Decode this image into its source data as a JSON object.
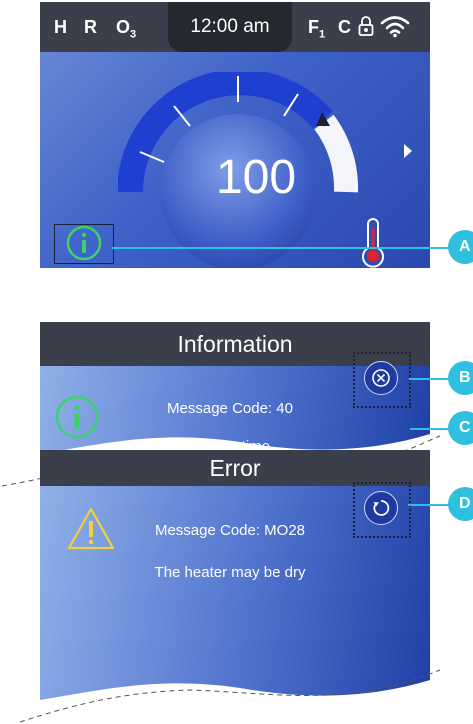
{
  "status_bar": {
    "indicators_left": [
      "H",
      "R",
      "O",
      "3"
    ],
    "time": "12:00 am",
    "indicators_right": [
      "F",
      "1",
      "C"
    ],
    "icons": [
      "lock-icon",
      "wifi-icon"
    ]
  },
  "main": {
    "temperature": "100",
    "icons": [
      "info-icon",
      "thermometer-icon",
      "next-arrow-icon"
    ]
  },
  "callouts": [
    "A",
    "B",
    "C",
    "D"
  ],
  "information_popup": {
    "title": "Information",
    "message_code": "Message Code: 40",
    "message": "Set the time",
    "icons": [
      "info-icon",
      "close-icon"
    ]
  },
  "error_popup": {
    "title": "Error",
    "message_code": "Message Code: MO28",
    "message": "The heater may be dry",
    "icons": [
      "warning-icon",
      "reset-icon"
    ]
  },
  "colors": {
    "status_bar": "#3b3f4c",
    "accent_callout": "#2fc0df",
    "info_green": "#3bd26a",
    "warning_yellow": "#f0d23a",
    "dial_blue": "#1f3fd0"
  }
}
